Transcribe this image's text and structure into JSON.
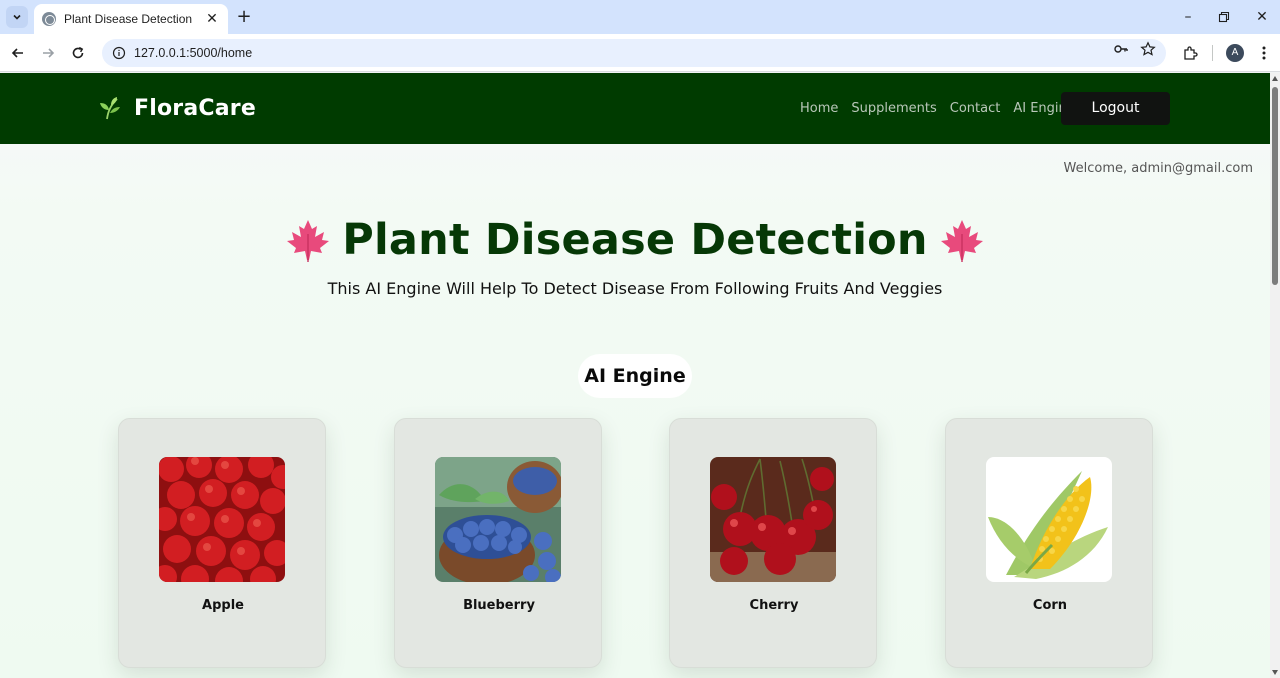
{
  "browser": {
    "tab_title": "Plant Disease Detection",
    "url": "127.0.0.1:5000/home",
    "profile_initial": "A"
  },
  "navbar": {
    "brand": "FloraCare",
    "links": [
      "Home",
      "Supplements",
      "Contact",
      "AI Engine"
    ],
    "logout_label": "Logout"
  },
  "welcome_text": "Welcome, admin@gmail.com",
  "hero": {
    "title": "Plant Disease Detection",
    "subtitle": "This AI Engine Will Help To Detect Disease From Following Fruits And Veggies"
  },
  "section_label": "AI Engine",
  "cards": [
    {
      "name": "Apple",
      "icon": "apple-image"
    },
    {
      "name": "Blueberry",
      "icon": "blueberry-image"
    },
    {
      "name": "Cherry",
      "icon": "cherry-image"
    },
    {
      "name": "Corn",
      "icon": "corn-image"
    }
  ],
  "colors": {
    "navbar": "#003b00",
    "title": "#063806",
    "card": "#e3e7e2",
    "logout": "#111311"
  }
}
